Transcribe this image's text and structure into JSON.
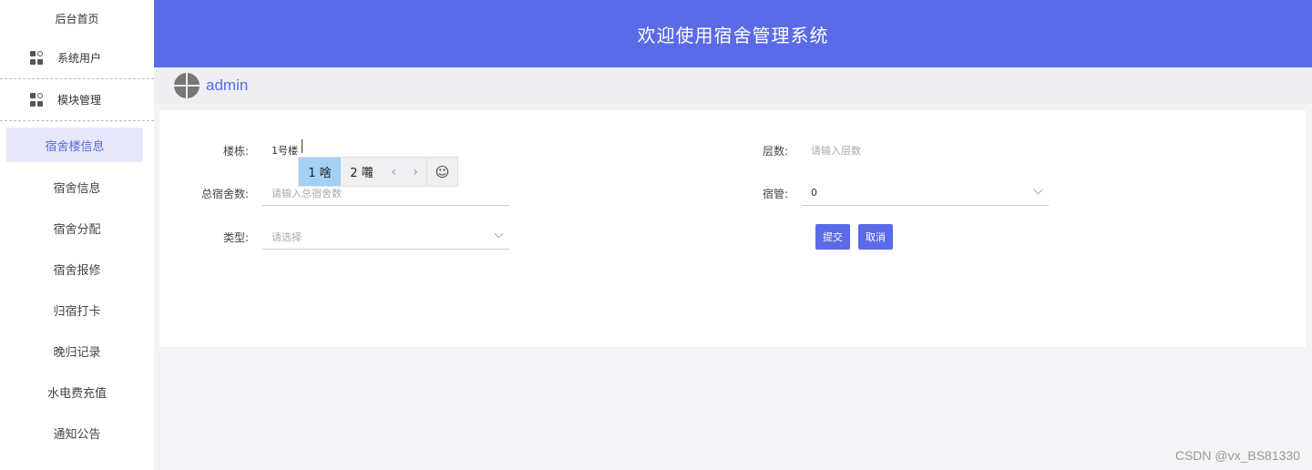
{
  "sidebar": {
    "home": "后台首页",
    "groups": [
      {
        "label": "系统用户"
      },
      {
        "label": "模块管理"
      }
    ],
    "items": [
      {
        "label": "宿舍楼信息",
        "active": true
      },
      {
        "label": "宿舍信息"
      },
      {
        "label": "宿舍分配"
      },
      {
        "label": "宿舍报修"
      },
      {
        "label": "归宿打卡"
      },
      {
        "label": "晚归记录"
      },
      {
        "label": "水电费充值"
      },
      {
        "label": "通知公告"
      }
    ]
  },
  "header": {
    "title": "欢迎使用宿舍管理系统"
  },
  "user": {
    "name": "admin"
  },
  "form": {
    "building": {
      "label": "楼栋:",
      "value": "1号楼"
    },
    "floors": {
      "label": "层数:",
      "placeholder": "请输入层数"
    },
    "total_rooms": {
      "label": "总宿舍数:",
      "placeholder": "请输入总宿舍数"
    },
    "manager": {
      "label": "宿管:",
      "value": "0"
    },
    "type": {
      "label": "类型:",
      "placeholder": "请选择"
    },
    "submit_label": "提交",
    "cancel_label": "取消"
  },
  "ime": {
    "candidates": [
      "1 啥",
      "2 囖"
    ],
    "prev": "‹",
    "next": "›",
    "emoji": "☺"
  },
  "watermark": "CSDN @vx_BS81330",
  "colors": {
    "accent": "#5b6ae6",
    "active_bg": "#e6e8f9",
    "ime_selected": "#a4d0f5"
  }
}
